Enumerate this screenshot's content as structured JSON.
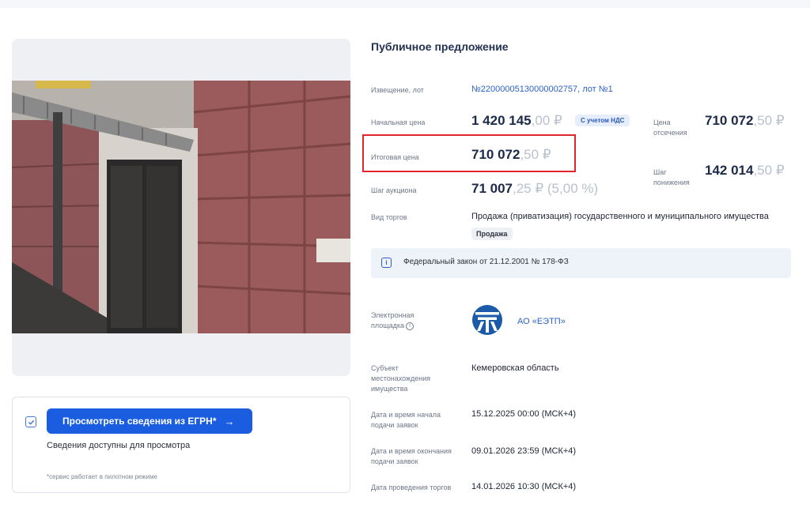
{
  "offer": {
    "title": "Публичное предложение",
    "notice": {
      "label": "Извещение, лот",
      "value": "№22000005130000002757, лот №1"
    },
    "start_price": {
      "label": "Начальная цена",
      "main": "1 420 145",
      "frac": ",00 ₽",
      "badge": "С учетом НДС"
    },
    "cutoff_price": {
      "label": "Цена отсечения",
      "main": "710 072",
      "frac": ",50 ₽"
    },
    "final_price": {
      "label": "Итоговая цена",
      "main": "710 072",
      "frac": ",50 ₽"
    },
    "decrease_step": {
      "label": "Шаг понижения",
      "main": "142 014",
      "frac": ",50 ₽"
    },
    "auction_step": {
      "label": "Шаг аукциона",
      "main": "71 007",
      "frac": ",25 ₽ (5,00 %)"
    },
    "trade_type": {
      "label": "Вид торгов",
      "value": "Продажа (приватизация) государственного и муниципального имущества",
      "badge": "Продажа"
    },
    "law": "Федеральный закон от 21.12.2001 № 178-ФЗ",
    "platform": {
      "label": "Электронная площадка",
      "value": "АО «ЕЭТП»"
    },
    "region": {
      "label": "Субъект местонахождения имущества",
      "value": "Кемеровская область"
    },
    "apps_start": {
      "label": "Дата и время начала подачи заявок",
      "value": "15.12.2025 00:00 (МСК+4)"
    },
    "apps_end": {
      "label": "Дата и время окончания подачи заявок",
      "value": "09.01.2026 23:59 (МСК+4)"
    },
    "auction_date": {
      "label": "Дата проведения торгов",
      "value": "14.01.2026 10:30 (МСК+4)"
    }
  },
  "egrn": {
    "button_label": "Просмотреть сведения из ЕГРН*",
    "status": "Сведения доступны для просмотра",
    "note": "*сервис работает в пилотном режиме"
  },
  "icons": {
    "arrow": "arrow-right-icon",
    "check": "shield-check-icon",
    "info": "info-icon",
    "question": "question-icon",
    "logo": "eetp-logo"
  },
  "colors": {
    "accent": "#1a5de0",
    "link": "#2d63c8",
    "highlight": "#e0262b",
    "muted_price": "#b9c1cd"
  }
}
